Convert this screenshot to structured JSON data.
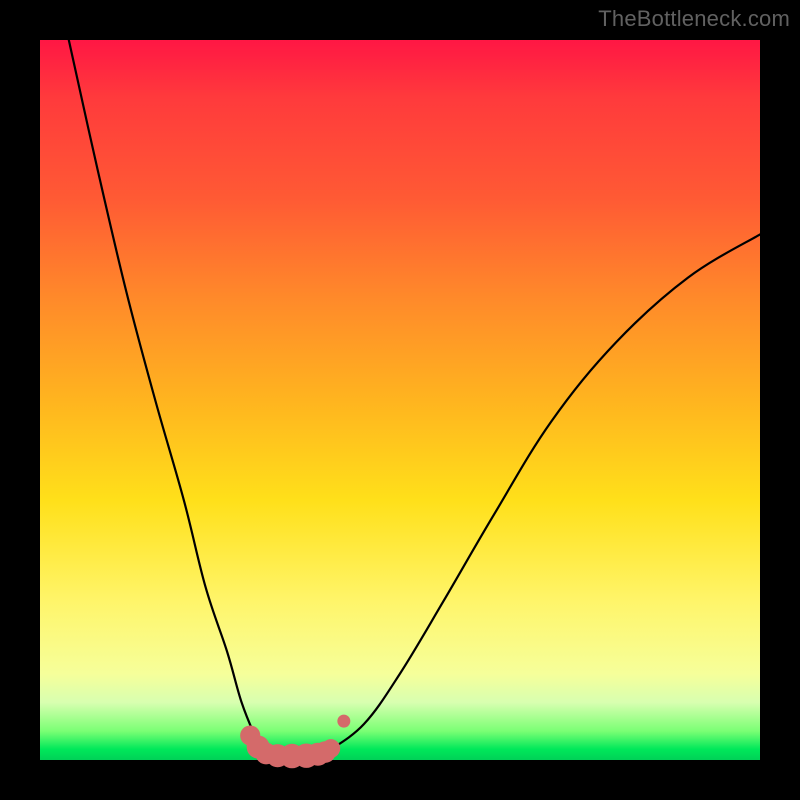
{
  "watermark": "TheBottleneck.com",
  "colors": {
    "frame": "#000000",
    "curve": "#000000",
    "marker": "#d46a6a",
    "gradient_top": "#ff1744",
    "gradient_bottom": "#00d157"
  },
  "chart_data": {
    "type": "line",
    "title": "",
    "xlabel": "",
    "ylabel": "",
    "xlim": [
      0,
      100
    ],
    "ylim": [
      0,
      100
    ],
    "grid": false,
    "legend": false,
    "note": "Axes have no visible tick labels. Values are approximate positions (percent of plot width/height, origin at bottom-left) read from the plot.",
    "series": [
      {
        "name": "left-branch",
        "x": [
          4,
          8,
          12,
          16,
          20,
          23,
          26,
          28,
          30,
          31
        ],
        "y": [
          100,
          82,
          65,
          50,
          36,
          24,
          15,
          8,
          3,
          1
        ]
      },
      {
        "name": "valley",
        "x": [
          31,
          33,
          35,
          37,
          39,
          40
        ],
        "y": [
          1,
          0.5,
          0.5,
          0.5,
          0.7,
          1.2
        ]
      },
      {
        "name": "right-branch",
        "x": [
          40,
          45,
          50,
          56,
          63,
          71,
          80,
          90,
          100
        ],
        "y": [
          1.2,
          5,
          12,
          22,
          34,
          47,
          58,
          67,
          73
        ]
      }
    ],
    "markers": {
      "name": "pink-markers-near-minimum",
      "x": [
        29.2,
        30.3,
        31.4,
        33.0,
        35.0,
        37.0,
        38.6,
        39.6,
        40.4,
        42.2
      ],
      "y": [
        3.4,
        1.8,
        0.9,
        0.6,
        0.55,
        0.6,
        0.8,
        1.1,
        1.6,
        5.4
      ],
      "r": [
        1.4,
        1.6,
        1.5,
        1.6,
        1.7,
        1.7,
        1.6,
        1.5,
        1.3,
        0.9
      ]
    }
  }
}
